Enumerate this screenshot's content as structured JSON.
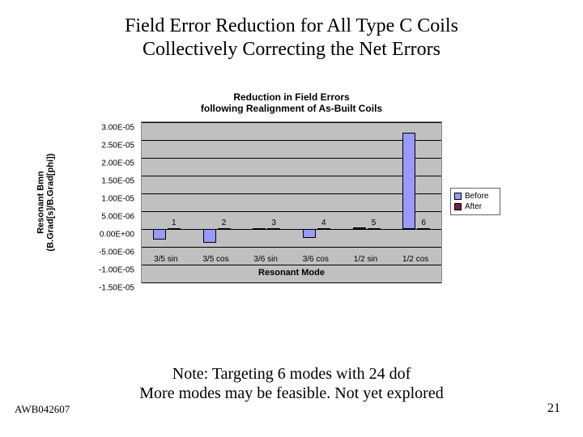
{
  "title_line1": "Field Error Reduction for All Type C Coils",
  "title_line2": "Collectively Correcting the Net Errors",
  "note_line1": "Note: Targeting 6 modes with 24 dof",
  "note_line2": "More modes may be feasible. Not yet explored",
  "footer_left": "AWB042607",
  "footer_right": "21",
  "chart_data": {
    "type": "bar",
    "title_line1": "Reduction in Field Errors",
    "title_line2": "following Realignment of As-Built Coils",
    "ylabel_line1": "Resonant Bmn",
    "ylabel_line2": "(B.Grad[s]/B.Grad[phi])",
    "xlabel": "Resonant Mode",
    "categories": [
      "3/5 sin",
      "3/5 cos",
      "3/6 sin",
      "3/6 cos",
      "1/2 sin",
      "1/2 cos"
    ],
    "series": [
      {
        "name": "Before",
        "color": "#9999ff",
        "values": [
          -3e-06,
          -4e-06,
          2e-07,
          -2.5e-06,
          5e-07,
          2.7e-05
        ]
      },
      {
        "name": "After",
        "color": "#7a1f3d",
        "values": [
          1e-07,
          1e-07,
          1e-07,
          1e-07,
          1e-07,
          1e-07
        ]
      }
    ],
    "ylim": [
      -1.5e-05,
      3e-05
    ],
    "yticks": [
      "3.00E-05",
      "2.50E-05",
      "2.00E-05",
      "1.50E-05",
      "1.00E-05",
      "5.00E-06",
      "0.00E+00",
      "-5.00E-06",
      "-1.00E-05",
      "-1.50E-05"
    ],
    "point_labels": [
      "1",
      "2",
      "",
      "3",
      "4",
      "5",
      "6"
    ],
    "legend": [
      "Before",
      "After"
    ]
  }
}
